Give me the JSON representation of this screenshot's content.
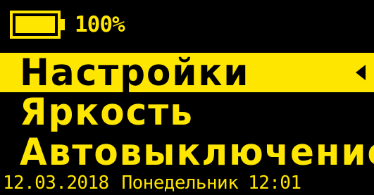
{
  "status": {
    "battery_icon": "battery-full-icon",
    "battery_level": 1.0,
    "battery_text": "100%"
  },
  "menu": {
    "items": [
      {
        "label": "Настройки",
        "selected": true
      },
      {
        "label": "Яркость",
        "selected": false
      },
      {
        "label": "Автовыключение",
        "selected": false
      }
    ],
    "cursor_icon": "triangle-left-icon"
  },
  "footer": {
    "date": "12.03.2018",
    "weekday": "Понедельник",
    "time": "12:01"
  },
  "colors": {
    "foreground": "#FFE600",
    "background": "#000000"
  }
}
